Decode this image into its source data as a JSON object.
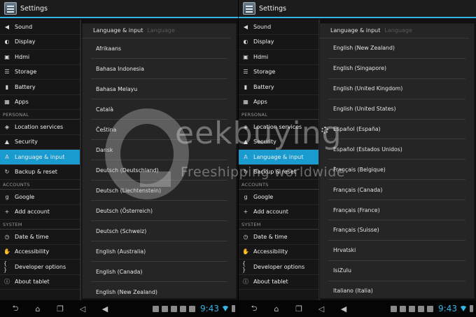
{
  "left": {
    "title": "Settings",
    "sidebar": [
      {
        "type": "item",
        "icon": "speaker-icon",
        "glyph": "◀",
        "label": "Sound"
      },
      {
        "type": "item",
        "icon": "display-icon",
        "glyph": "◐",
        "label": "Display"
      },
      {
        "type": "item",
        "icon": "hdmi-icon",
        "glyph": "▣",
        "label": "Hdmi"
      },
      {
        "type": "item",
        "icon": "storage-icon",
        "glyph": "☰",
        "label": "Storage"
      },
      {
        "type": "item",
        "icon": "battery-icon",
        "glyph": "▮",
        "label": "Battery"
      },
      {
        "type": "item",
        "icon": "apps-icon",
        "glyph": "▦",
        "label": "Apps"
      },
      {
        "type": "header",
        "label": "PERSONAL"
      },
      {
        "type": "item",
        "icon": "location-icon",
        "glyph": "◈",
        "label": "Location services"
      },
      {
        "type": "item",
        "icon": "lock-icon",
        "glyph": "▲",
        "label": "Security"
      },
      {
        "type": "item",
        "icon": "keyboard-icon",
        "glyph": "A",
        "label": "Language & input",
        "active": true
      },
      {
        "type": "item",
        "icon": "backup-icon",
        "glyph": "↻",
        "label": "Backup & reset"
      },
      {
        "type": "header",
        "label": "ACCOUNTS"
      },
      {
        "type": "item",
        "icon": "google-icon",
        "glyph": "g",
        "label": "Google"
      },
      {
        "type": "item",
        "icon": "plus-icon",
        "glyph": "+",
        "label": "Add account"
      },
      {
        "type": "header",
        "label": "SYSTEM"
      },
      {
        "type": "item",
        "icon": "clock-icon",
        "glyph": "◷",
        "label": "Date & time"
      },
      {
        "type": "item",
        "icon": "hand-icon",
        "glyph": "✋",
        "label": "Accessibility"
      },
      {
        "type": "item",
        "icon": "braces-icon",
        "glyph": "{ }",
        "label": "Developer options"
      },
      {
        "type": "item",
        "icon": "info-icon",
        "glyph": "ⓘ",
        "label": "About tablet"
      }
    ],
    "panel_title": "Language & input",
    "panel_subtitle": "Language",
    "languages": [
      "Afrikaans",
      "Bahasa Indonesia",
      "Bahasa Melayu",
      "Català",
      "Čeština",
      "Dansk",
      "Deutsch (Deutschland)",
      "Deutsch (Liechtenstein)",
      "Deutsch (Österreich)",
      "Deutsch (Schweiz)",
      "English (Australia)",
      "English (Canada)",
      "English (New Zealand)"
    ],
    "time": "9:43"
  },
  "right": {
    "title": "Settings",
    "panel_title": "Language & input",
    "panel_subtitle": "Language",
    "languages": [
      "English (New Zealand)",
      "English (Singapore)",
      "English (United Kingdom)",
      "English (United States)",
      "Español (España)",
      "Español (Estados Unidos)",
      "Français (Belgique)",
      "Français (Canada)",
      "Français (France)",
      "Français (Suisse)",
      "Hrvatski",
      "IsiZulu",
      "Italiano (Italia)"
    ],
    "time": "9:43"
  },
  "watermark": {
    "brand": "eekbuying",
    "tagline": "Freeshipping worldwide"
  },
  "colors": {
    "accent": "#33b5e5",
    "active_item": "#1a9bd0"
  }
}
